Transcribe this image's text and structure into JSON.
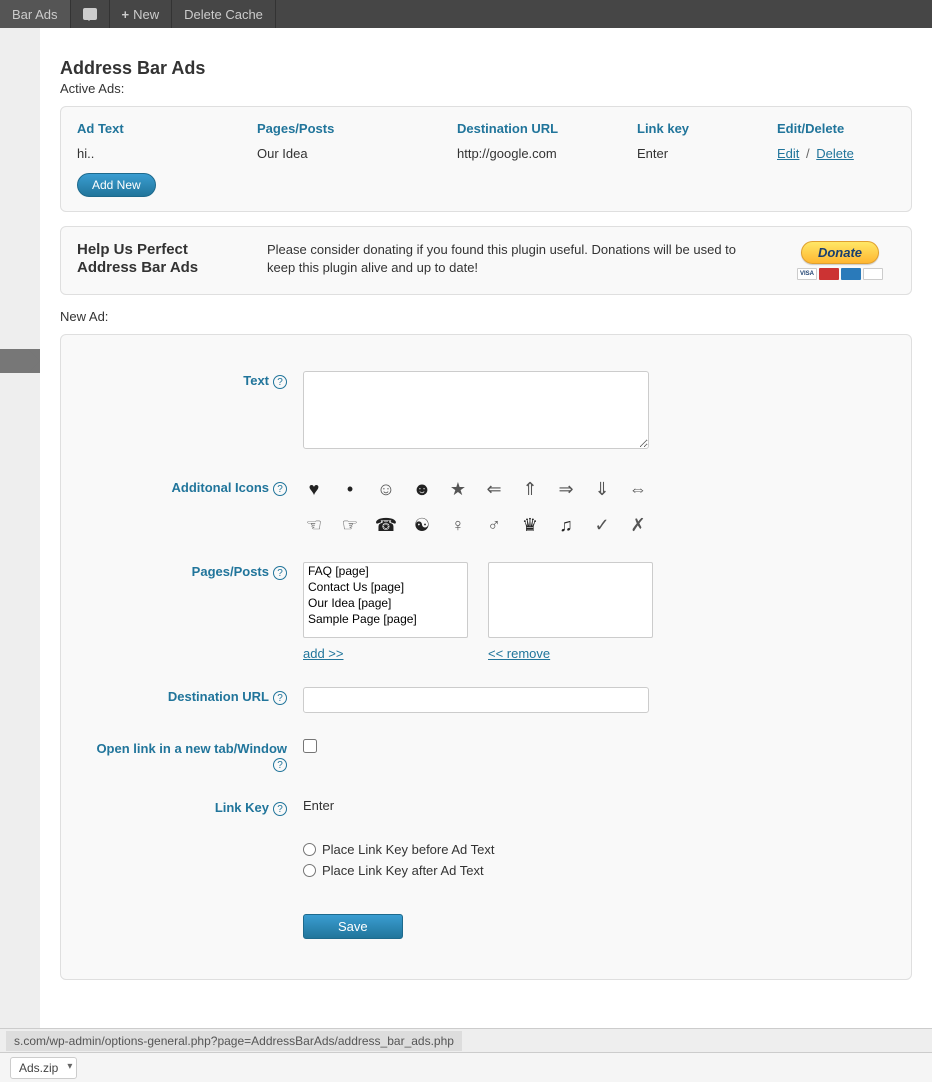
{
  "toolbar": {
    "bar_ads": "Bar Ads",
    "new_label": "New",
    "delete_cache": "Delete Cache"
  },
  "page": {
    "title": "Address Bar Ads",
    "active_label": "Active Ads:"
  },
  "table": {
    "headers": {
      "ad_text": "Ad Text",
      "pages": "Pages/Posts",
      "dest": "Destination URL",
      "link_key": "Link key",
      "edit_delete": "Edit/Delete"
    },
    "row": {
      "ad_text": "hi..",
      "pages": "Our Idea",
      "dest": "http://google.com",
      "link_key": "Enter",
      "edit": "Edit",
      "delete": "Delete"
    },
    "add_new": "Add New"
  },
  "donate": {
    "title": "Help Us Perfect Address Bar Ads",
    "text": "Please consider donating if you found this plugin useful. Donations will be used to keep this plugin alive and up to date!",
    "btn": "Donate"
  },
  "newad_label": "New Ad:",
  "form": {
    "text_label": "Text",
    "icons_label": "Additonal Icons",
    "pages_label": "Pages/Posts",
    "pages_options": [
      "FAQ  [page]",
      "Contact Us  [page]",
      "Our Idea  [page]",
      "Sample Page  [page]"
    ],
    "add_link": "add >>",
    "remove_link": "<< remove",
    "dest_label": "Destination URL",
    "open_new_label": "Open link in a new tab/Window",
    "link_key_label": "Link Key",
    "link_key_value": "Enter",
    "radio_before": "Place Link Key before Ad Text",
    "radio_after": "Place Link Key after Ad Text",
    "save": "Save"
  },
  "status_url": "s.com/wp-admin/options-general.php?page=AddressBarAds/address_bar_ads.php",
  "download_file": "Ads.zip"
}
